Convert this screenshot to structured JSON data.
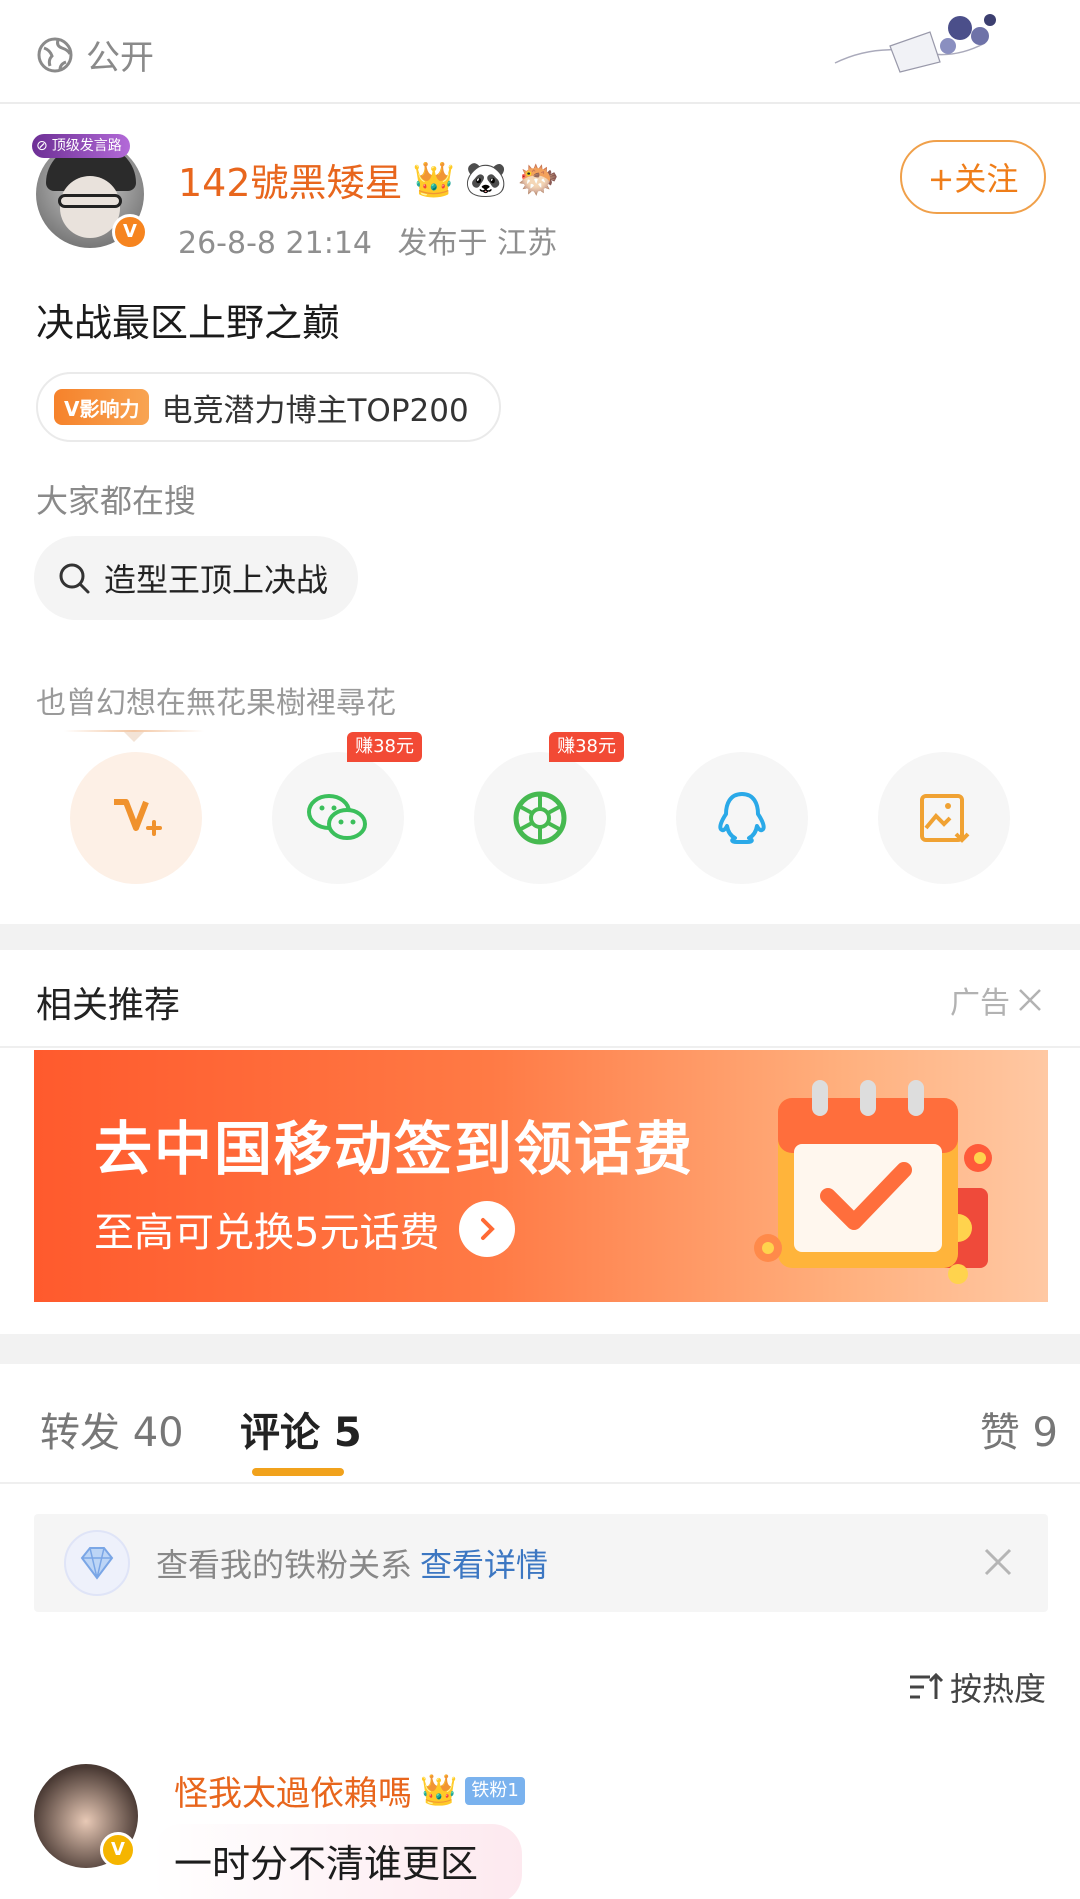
{
  "visibility": {
    "label": "公开",
    "icon": "globe-icon"
  },
  "post": {
    "author": {
      "name": "142號黑矮星",
      "frame_badge": "顶级发言路",
      "verified": "V",
      "emojis": [
        "👑",
        "🐼",
        "🐡"
      ]
    },
    "time": "26-8-8 21:14",
    "location": "发布于 江苏",
    "follow_label": "+关注",
    "text": "决战最区上野之巅",
    "influence": {
      "tag": "V影响力",
      "label": "电竞潜力博主TOP200"
    },
    "search": {
      "label": "大家都在搜",
      "query": "造型王顶上决战"
    },
    "signature": "也曾幻想在無花果樹裡尋花",
    "share": [
      {
        "name": "weibo-repost",
        "badge": ""
      },
      {
        "name": "wechat",
        "badge": "赚38元"
      },
      {
        "name": "moments",
        "badge": "赚38元"
      },
      {
        "name": "qq",
        "badge": ""
      },
      {
        "name": "save-image",
        "badge": ""
      }
    ]
  },
  "recommend": {
    "title": "相关推荐",
    "ad_label": "广告",
    "banner": {
      "title": "去中国移动签到领话费",
      "subtitle": "至高可兑换5元话费"
    }
  },
  "tabs": {
    "repost": "转发 40",
    "comments": "评论 5",
    "likes": "赞 9"
  },
  "fan_card": {
    "text": "查看我的铁粉关系",
    "link": "查看详情"
  },
  "sort_label": "按热度",
  "comments": [
    {
      "name": "怪我太過依賴嗎",
      "fan_badge": "铁粉1",
      "text": "一时分不清谁更区"
    }
  ],
  "colors": {
    "accent": "#ef7d18",
    "tab_underline": "#f1a21c",
    "link": "#3c77c2"
  }
}
